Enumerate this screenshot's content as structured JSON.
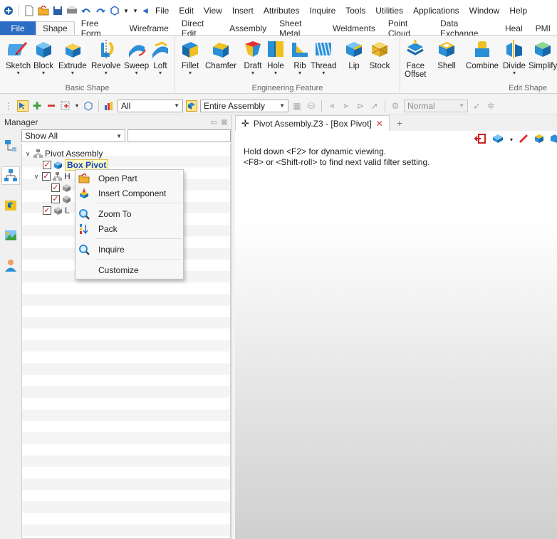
{
  "menu_bar": {
    "items": [
      "File",
      "Edit",
      "View",
      "Insert",
      "Attributes",
      "Inquire",
      "Tools",
      "Utilities",
      "Applications",
      "Window",
      "Help"
    ]
  },
  "ribbon_tabs": [
    "File",
    "Shape",
    "Free Form",
    "Wireframe",
    "Direct Edit",
    "Assembly",
    "Sheet Metal",
    "Weldments",
    "Point Cloud",
    "Data Exchange",
    "Heal",
    "PMI"
  ],
  "active_tab": "Shape",
  "ribbon": {
    "basic_shape": {
      "label": "Basic Shape",
      "buttons": [
        "Sketch",
        "Block",
        "Extrude",
        "Revolve",
        "Sweep",
        "Loft"
      ]
    },
    "engineering_feature": {
      "label": "Engineering Feature",
      "buttons": [
        "Fillet",
        "Chamfer",
        "Draft",
        "Hole",
        "Rib",
        "Thread",
        "Lip",
        "Stock"
      ]
    },
    "edit_shape": {
      "label": "Edit Shape",
      "face_offset": [
        "Face",
        "Offset"
      ],
      "buttons": [
        "Shell",
        "Combine",
        "Divide",
        "Simplify"
      ]
    }
  },
  "toolbar": {
    "filter_value": "All",
    "scope_value": "Entire Assembly",
    "render_mode": "Normal"
  },
  "manager": {
    "title": "Manager",
    "show_filter": "Show All",
    "tree": {
      "root": "Pivot Assembly",
      "selected_child": "Box Pivot",
      "partial_child_1": "H",
      "partial_child_2": "L"
    }
  },
  "context_menu": {
    "items": [
      "Open Part",
      "Insert Component",
      "Zoom To",
      "Pack",
      "Inquire",
      "Customize"
    ]
  },
  "document": {
    "tab_label": "Pivot Assembly.Z3 - [Box Pivot]",
    "hint_line_1": "Hold down <F2> for dynamic viewing.",
    "hint_line_2": "<F8> or <Shift-roll> to find next valid filter setting."
  },
  "colors": {
    "accent": "#2b6cc4",
    "check_red": "#d01010",
    "highlight_bg": "#fffbc4",
    "icon_blue": "#2a8fd6",
    "icon_yellow": "#f0c020"
  }
}
